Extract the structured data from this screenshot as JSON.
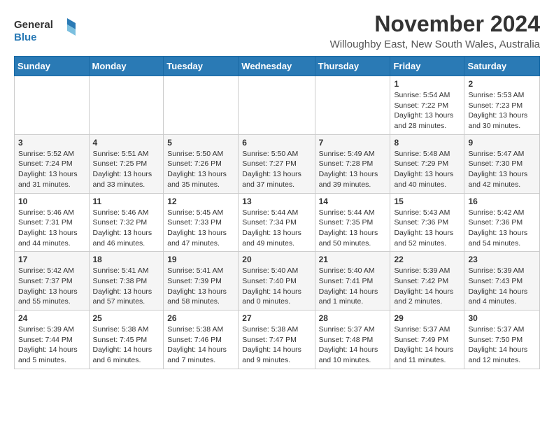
{
  "logo": {
    "line1": "General",
    "line2": "Blue"
  },
  "header": {
    "month": "November 2024",
    "location": "Willoughby East, New South Wales, Australia"
  },
  "weekdays": [
    "Sunday",
    "Monday",
    "Tuesday",
    "Wednesday",
    "Thursday",
    "Friday",
    "Saturday"
  ],
  "weeks": [
    [
      {
        "day": "",
        "info": ""
      },
      {
        "day": "",
        "info": ""
      },
      {
        "day": "",
        "info": ""
      },
      {
        "day": "",
        "info": ""
      },
      {
        "day": "",
        "info": ""
      },
      {
        "day": "1",
        "info": "Sunrise: 5:54 AM\nSunset: 7:22 PM\nDaylight: 13 hours and 28 minutes."
      },
      {
        "day": "2",
        "info": "Sunrise: 5:53 AM\nSunset: 7:23 PM\nDaylight: 13 hours and 30 minutes."
      }
    ],
    [
      {
        "day": "3",
        "info": "Sunrise: 5:52 AM\nSunset: 7:24 PM\nDaylight: 13 hours and 31 minutes."
      },
      {
        "day": "4",
        "info": "Sunrise: 5:51 AM\nSunset: 7:25 PM\nDaylight: 13 hours and 33 minutes."
      },
      {
        "day": "5",
        "info": "Sunrise: 5:50 AM\nSunset: 7:26 PM\nDaylight: 13 hours and 35 minutes."
      },
      {
        "day": "6",
        "info": "Sunrise: 5:50 AM\nSunset: 7:27 PM\nDaylight: 13 hours and 37 minutes."
      },
      {
        "day": "7",
        "info": "Sunrise: 5:49 AM\nSunset: 7:28 PM\nDaylight: 13 hours and 39 minutes."
      },
      {
        "day": "8",
        "info": "Sunrise: 5:48 AM\nSunset: 7:29 PM\nDaylight: 13 hours and 40 minutes."
      },
      {
        "day": "9",
        "info": "Sunrise: 5:47 AM\nSunset: 7:30 PM\nDaylight: 13 hours and 42 minutes."
      }
    ],
    [
      {
        "day": "10",
        "info": "Sunrise: 5:46 AM\nSunset: 7:31 PM\nDaylight: 13 hours and 44 minutes."
      },
      {
        "day": "11",
        "info": "Sunrise: 5:46 AM\nSunset: 7:32 PM\nDaylight: 13 hours and 46 minutes."
      },
      {
        "day": "12",
        "info": "Sunrise: 5:45 AM\nSunset: 7:33 PM\nDaylight: 13 hours and 47 minutes."
      },
      {
        "day": "13",
        "info": "Sunrise: 5:44 AM\nSunset: 7:34 PM\nDaylight: 13 hours and 49 minutes."
      },
      {
        "day": "14",
        "info": "Sunrise: 5:44 AM\nSunset: 7:35 PM\nDaylight: 13 hours and 50 minutes."
      },
      {
        "day": "15",
        "info": "Sunrise: 5:43 AM\nSunset: 7:36 PM\nDaylight: 13 hours and 52 minutes."
      },
      {
        "day": "16",
        "info": "Sunrise: 5:42 AM\nSunset: 7:36 PM\nDaylight: 13 hours and 54 minutes."
      }
    ],
    [
      {
        "day": "17",
        "info": "Sunrise: 5:42 AM\nSunset: 7:37 PM\nDaylight: 13 hours and 55 minutes."
      },
      {
        "day": "18",
        "info": "Sunrise: 5:41 AM\nSunset: 7:38 PM\nDaylight: 13 hours and 57 minutes."
      },
      {
        "day": "19",
        "info": "Sunrise: 5:41 AM\nSunset: 7:39 PM\nDaylight: 13 hours and 58 minutes."
      },
      {
        "day": "20",
        "info": "Sunrise: 5:40 AM\nSunset: 7:40 PM\nDaylight: 14 hours and 0 minutes."
      },
      {
        "day": "21",
        "info": "Sunrise: 5:40 AM\nSunset: 7:41 PM\nDaylight: 14 hours and 1 minute."
      },
      {
        "day": "22",
        "info": "Sunrise: 5:39 AM\nSunset: 7:42 PM\nDaylight: 14 hours and 2 minutes."
      },
      {
        "day": "23",
        "info": "Sunrise: 5:39 AM\nSunset: 7:43 PM\nDaylight: 14 hours and 4 minutes."
      }
    ],
    [
      {
        "day": "24",
        "info": "Sunrise: 5:39 AM\nSunset: 7:44 PM\nDaylight: 14 hours and 5 minutes."
      },
      {
        "day": "25",
        "info": "Sunrise: 5:38 AM\nSunset: 7:45 PM\nDaylight: 14 hours and 6 minutes."
      },
      {
        "day": "26",
        "info": "Sunrise: 5:38 AM\nSunset: 7:46 PM\nDaylight: 14 hours and 7 minutes."
      },
      {
        "day": "27",
        "info": "Sunrise: 5:38 AM\nSunset: 7:47 PM\nDaylight: 14 hours and 9 minutes."
      },
      {
        "day": "28",
        "info": "Sunrise: 5:37 AM\nSunset: 7:48 PM\nDaylight: 14 hours and 10 minutes."
      },
      {
        "day": "29",
        "info": "Sunrise: 5:37 AM\nSunset: 7:49 PM\nDaylight: 14 hours and 11 minutes."
      },
      {
        "day": "30",
        "info": "Sunrise: 5:37 AM\nSunset: 7:50 PM\nDaylight: 14 hours and 12 minutes."
      }
    ]
  ]
}
